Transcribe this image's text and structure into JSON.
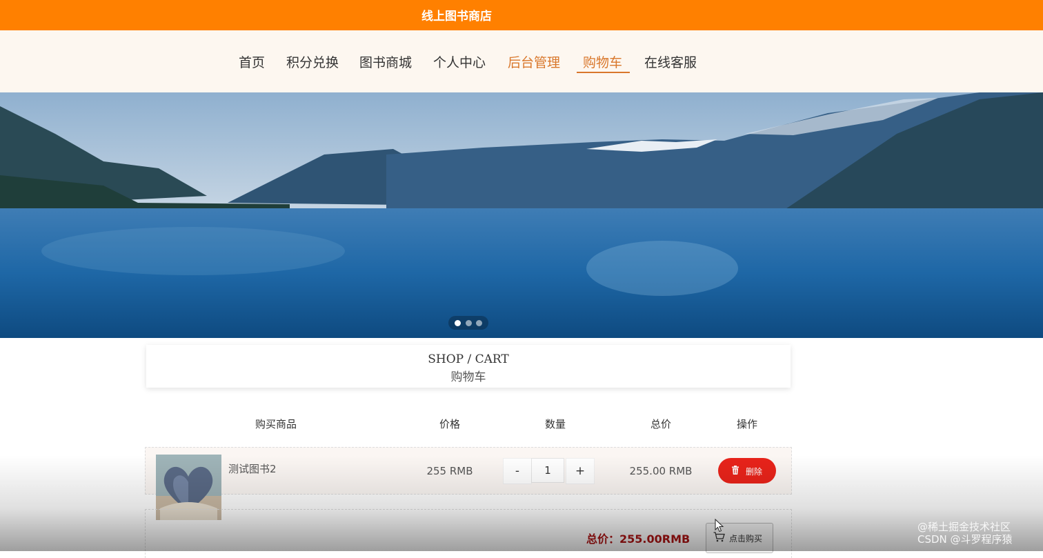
{
  "header": {
    "site_title": "线上图书商店"
  },
  "nav": {
    "items": [
      {
        "label": "首页"
      },
      {
        "label": "积分兑换"
      },
      {
        "label": "图书商城"
      },
      {
        "label": "个人中心"
      },
      {
        "label": "后台管理"
      },
      {
        "label": "购物车"
      },
      {
        "label": "在线客服"
      }
    ],
    "active": "购物车",
    "accent_color": "#d9772b"
  },
  "banner": {
    "slide_count": 3,
    "active_slide": 1
  },
  "cart_heading": {
    "en": "SHOP / CART",
    "cn": "购物车"
  },
  "table": {
    "headers": [
      "购买商品",
      "价格",
      "数量",
      "总价",
      "操作"
    ],
    "rows": [
      {
        "name": "测试图书2",
        "price": "255 RMB",
        "qty_minus": "-",
        "quantity": "1",
        "qty_plus": "+",
        "total": "255.00 RMB",
        "delete_label": "删除",
        "delete_icon": "trash-icon"
      }
    ]
  },
  "summary": {
    "total_label": "总价：255.00RMB",
    "buy_label": "点击购买",
    "buy_icon": "cart-icon"
  },
  "watermark": {
    "line1": "@稀土掘金技术社区",
    "line2": "CSDN @斗罗程序猿"
  },
  "colors": {
    "topbar": "#ff8000",
    "delete": "#e8231a",
    "total": "#b01414"
  }
}
